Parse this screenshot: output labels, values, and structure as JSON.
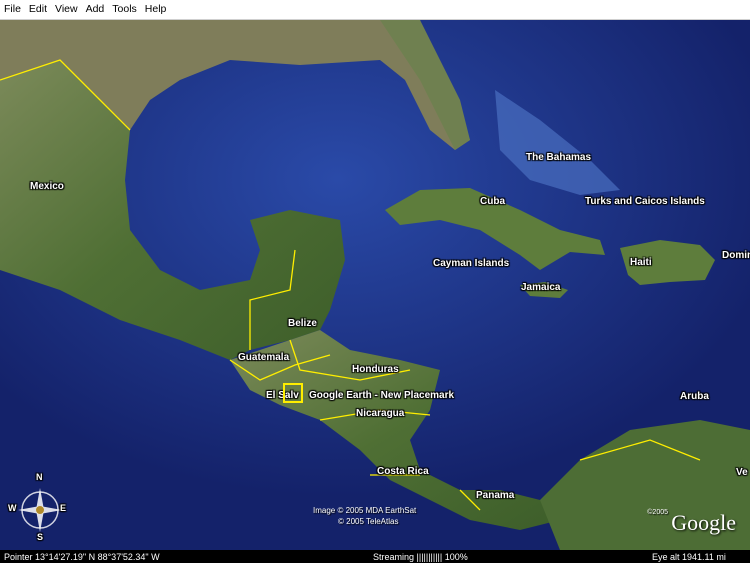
{
  "menu": [
    "File",
    "Edit",
    "View",
    "Add",
    "Tools",
    "Help"
  ],
  "labels": {
    "mexico": "Mexico",
    "bahamas": "The Bahamas",
    "cuba": "Cuba",
    "turks": "Turks and Caicos Islands",
    "cayman": "Cayman Islands",
    "haiti": "Haiti",
    "jamaica": "Jamaica",
    "belize": "Belize",
    "guatemala": "Guatemala",
    "honduras": "Honduras",
    "elsalv": "El Salv",
    "placemark": "Google Earth - New Placemark",
    "nicaragua": "Nicaragua",
    "aruba": "Aruba",
    "costarica": "Costa Rica",
    "panama": "Panama",
    "ve": "Ve",
    "domrep_edge": "Dominic"
  },
  "credits": {
    "line1": "Image © 2005 MDA EarthSat",
    "line2": "© 2005 TeleAtlas"
  },
  "brand": {
    "copyright": "©2005",
    "logo": "Google"
  },
  "compass": {
    "n": "N",
    "s": "S",
    "e": "E",
    "w": "W"
  },
  "status": {
    "pointer": "Pointer 13°14'27.19\" N   88°37'52.34\" W",
    "streaming": "Streaming ||||||||||| 100%",
    "eye": "Eye  alt  1941.11 mi"
  },
  "colors": {
    "ocean": "#1c2f7a",
    "border": "#ffee00",
    "land": "#5a7a3a"
  }
}
